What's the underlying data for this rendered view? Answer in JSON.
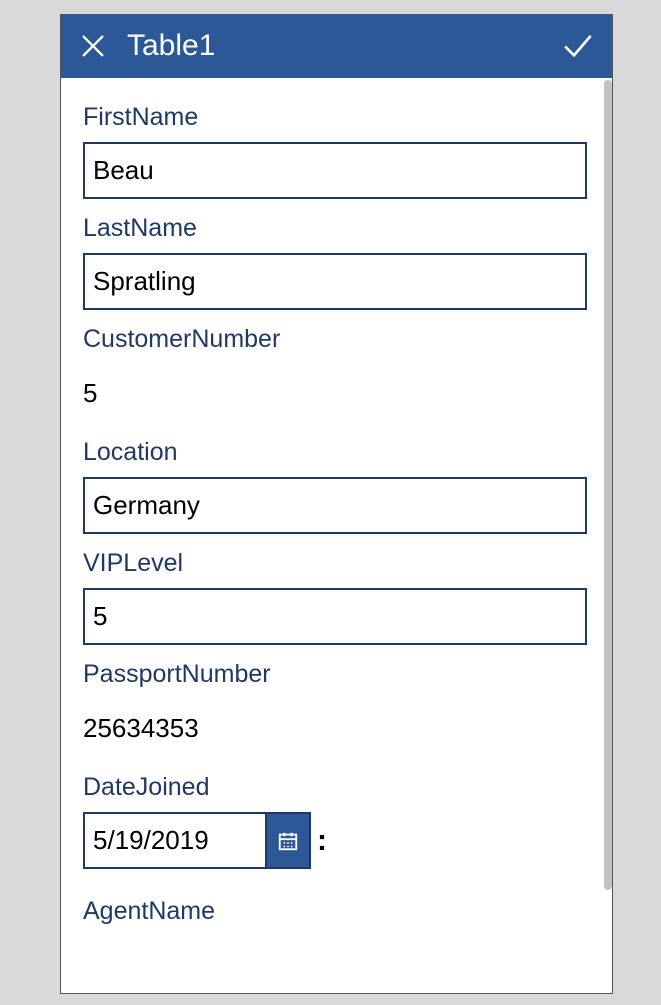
{
  "header": {
    "title": "Table1"
  },
  "form": {
    "firstName": {
      "label": "FirstName",
      "value": "Beau"
    },
    "lastName": {
      "label": "LastName",
      "value": "Spratling"
    },
    "customerNumber": {
      "label": "CustomerNumber",
      "value": "5"
    },
    "location": {
      "label": "Location",
      "value": "Germany"
    },
    "vipLevel": {
      "label": "VIPLevel",
      "value": "5"
    },
    "passportNumber": {
      "label": "PassportNumber",
      "value": "25634353"
    },
    "dateJoined": {
      "label": "DateJoined",
      "value": "5/19/2019",
      "separator": ":"
    },
    "agentName": {
      "label": "AgentName"
    }
  }
}
